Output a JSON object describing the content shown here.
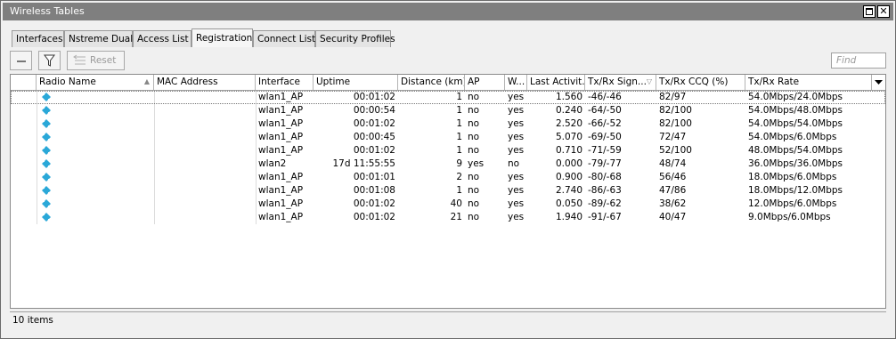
{
  "window": {
    "title": "Wireless Tables"
  },
  "tabs": [
    {
      "label": "Interfaces",
      "active": false
    },
    {
      "label": "Nstreme Dual",
      "active": false
    },
    {
      "label": "Access List",
      "active": false
    },
    {
      "label": "Registration",
      "active": true
    },
    {
      "label": "Connect List",
      "active": false
    },
    {
      "label": "Security Profiles",
      "active": false
    }
  ],
  "toolbar": {
    "reset_label": "Reset",
    "find_placeholder": "Find"
  },
  "columns": [
    "Radio Name",
    "MAC Address",
    "Interface",
    "Uptime",
    "Distance (km)",
    "AP",
    "W...",
    "Last Activit...",
    "Tx/Rx Sign...",
    "Tx/Rx CCQ (%)",
    "Tx/Rx Rate"
  ],
  "rows": [
    {
      "radio_name": "",
      "mac": "",
      "interface": "wlan1_AP",
      "uptime": "00:01:02",
      "distance": "1",
      "ap": "no",
      "wds": "yes",
      "last_activity": "1.560",
      "signal": "-46/-46",
      "ccq": "82/97",
      "rate": "54.0Mbps/24.0Mbps"
    },
    {
      "radio_name": "",
      "mac": "",
      "interface": "wlan1_AP",
      "uptime": "00:00:54",
      "distance": "1",
      "ap": "no",
      "wds": "yes",
      "last_activity": "0.240",
      "signal": "-64/-50",
      "ccq": "82/100",
      "rate": "54.0Mbps/48.0Mbps"
    },
    {
      "radio_name": "",
      "mac": "",
      "interface": "wlan1_AP",
      "uptime": "00:01:02",
      "distance": "1",
      "ap": "no",
      "wds": "yes",
      "last_activity": "2.520",
      "signal": "-66/-52",
      "ccq": "82/100",
      "rate": "54.0Mbps/54.0Mbps"
    },
    {
      "radio_name": "",
      "mac": "",
      "interface": "wlan1_AP",
      "uptime": "00:00:45",
      "distance": "1",
      "ap": "no",
      "wds": "yes",
      "last_activity": "5.070",
      "signal": "-69/-50",
      "ccq": "72/47",
      "rate": "54.0Mbps/6.0Mbps"
    },
    {
      "radio_name": "",
      "mac": "",
      "interface": "wlan1_AP",
      "uptime": "00:01:02",
      "distance": "1",
      "ap": "no",
      "wds": "yes",
      "last_activity": "0.710",
      "signal": "-71/-59",
      "ccq": "52/100",
      "rate": "48.0Mbps/54.0Mbps"
    },
    {
      "radio_name": "",
      "mac": "",
      "interface": "wlan2",
      "uptime": "17d 11:55:55",
      "distance": "9",
      "ap": "yes",
      "wds": "no",
      "last_activity": "0.000",
      "signal": "-79/-77",
      "ccq": "48/74",
      "rate": "36.0Mbps/36.0Mbps"
    },
    {
      "radio_name": "",
      "mac": "",
      "interface": "wlan1_AP",
      "uptime": "00:01:01",
      "distance": "2",
      "ap": "no",
      "wds": "yes",
      "last_activity": "0.900",
      "signal": "-80/-68",
      "ccq": "56/46",
      "rate": "18.0Mbps/6.0Mbps"
    },
    {
      "radio_name": "",
      "mac": "",
      "interface": "wlan1_AP",
      "uptime": "00:01:08",
      "distance": "1",
      "ap": "no",
      "wds": "yes",
      "last_activity": "2.740",
      "signal": "-86/-63",
      "ccq": "47/86",
      "rate": "18.0Mbps/12.0Mbps"
    },
    {
      "radio_name": "",
      "mac": "",
      "interface": "wlan1_AP",
      "uptime": "00:01:02",
      "distance": "40",
      "ap": "no",
      "wds": "yes",
      "last_activity": "0.050",
      "signal": "-89/-62",
      "ccq": "38/62",
      "rate": "12.0Mbps/6.0Mbps"
    },
    {
      "radio_name": "",
      "mac": "",
      "interface": "wlan1_AP",
      "uptime": "00:01:02",
      "distance": "21",
      "ap": "no",
      "wds": "yes",
      "last_activity": "1.940",
      "signal": "-91/-67",
      "ccq": "40/47",
      "rate": "9.0Mbps/6.0Mbps"
    }
  ],
  "status": {
    "count_text": "10 items"
  },
  "colors": {
    "titlebar": "#7f7f7f",
    "station_icon": "#2aa8d8"
  }
}
